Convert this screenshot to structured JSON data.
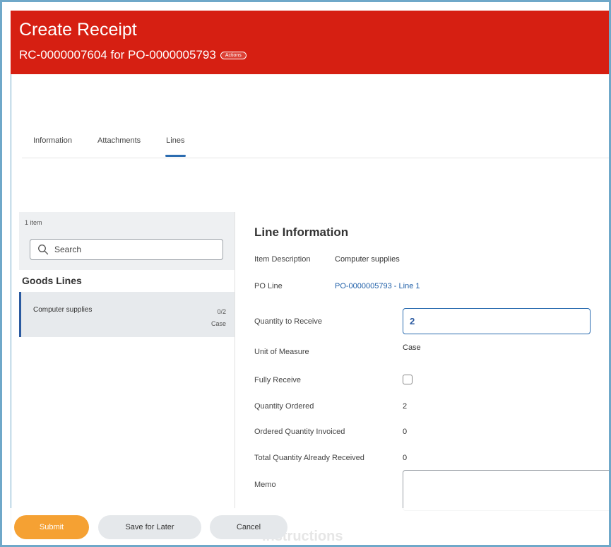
{
  "header": {
    "title": "Create Receipt",
    "subtitle": "RC-0000007604 for PO-0000005793",
    "actions_label": "Actions"
  },
  "tabs": [
    {
      "label": "Information",
      "active": false
    },
    {
      "label": "Attachments",
      "active": false
    },
    {
      "label": "Lines",
      "active": true
    }
  ],
  "left_panel": {
    "item_count": "1 item",
    "search_placeholder": "Search",
    "section_title": "Goods Lines",
    "lines": [
      {
        "name": "Computer supplies",
        "qty": "0/2",
        "unit": "Case"
      }
    ]
  },
  "line_info": {
    "title": "Line Information",
    "item_description_label": "Item Description",
    "item_description_value": "Computer supplies",
    "po_line_label": "PO Line",
    "po_line_value": "PO-0000005793 - Line 1",
    "quantity_to_receive_label": "Quantity to Receive",
    "quantity_to_receive_value": "2",
    "unit_of_measure_label": "Unit of Measure",
    "unit_of_measure_value": "Case",
    "fully_receive_label": "Fully Receive",
    "quantity_ordered_label": "Quantity Ordered",
    "quantity_ordered_value": "2",
    "ordered_quantity_invoiced_label": "Ordered Quantity Invoiced",
    "ordered_quantity_invoiced_value": "0",
    "total_received_label": "Total Quantity Already Received",
    "total_received_value": "0",
    "memo_label": "Memo",
    "instructions_label": "Instructions"
  },
  "footer": {
    "submit_label": "Submit",
    "save_label": "Save for Later",
    "cancel_label": "Cancel"
  },
  "colors": {
    "header": "#d61f12",
    "accent": "#2b6cb0",
    "submit": "#f5a133"
  }
}
